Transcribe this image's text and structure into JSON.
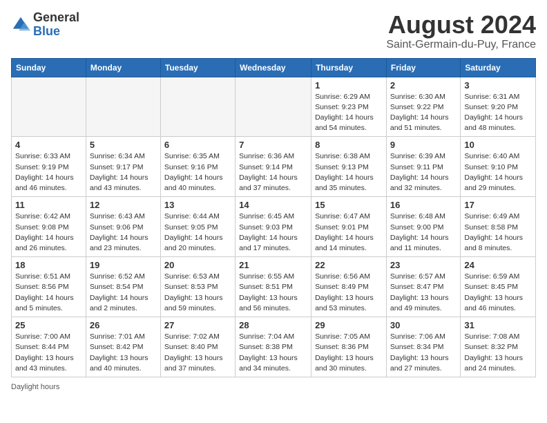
{
  "header": {
    "logo_general": "General",
    "logo_blue": "Blue",
    "month_title": "August 2024",
    "location": "Saint-Germain-du-Puy, France"
  },
  "days_of_week": [
    "Sunday",
    "Monday",
    "Tuesday",
    "Wednesday",
    "Thursday",
    "Friday",
    "Saturday"
  ],
  "footer": {
    "note": "Daylight hours"
  },
  "weeks": [
    [
      {
        "day": "",
        "info": ""
      },
      {
        "day": "",
        "info": ""
      },
      {
        "day": "",
        "info": ""
      },
      {
        "day": "",
        "info": ""
      },
      {
        "day": "1",
        "info": "Sunrise: 6:29 AM\nSunset: 9:23 PM\nDaylight: 14 hours\nand 54 minutes."
      },
      {
        "day": "2",
        "info": "Sunrise: 6:30 AM\nSunset: 9:22 PM\nDaylight: 14 hours\nand 51 minutes."
      },
      {
        "day": "3",
        "info": "Sunrise: 6:31 AM\nSunset: 9:20 PM\nDaylight: 14 hours\nand 48 minutes."
      }
    ],
    [
      {
        "day": "4",
        "info": "Sunrise: 6:33 AM\nSunset: 9:19 PM\nDaylight: 14 hours\nand 46 minutes."
      },
      {
        "day": "5",
        "info": "Sunrise: 6:34 AM\nSunset: 9:17 PM\nDaylight: 14 hours\nand 43 minutes."
      },
      {
        "day": "6",
        "info": "Sunrise: 6:35 AM\nSunset: 9:16 PM\nDaylight: 14 hours\nand 40 minutes."
      },
      {
        "day": "7",
        "info": "Sunrise: 6:36 AM\nSunset: 9:14 PM\nDaylight: 14 hours\nand 37 minutes."
      },
      {
        "day": "8",
        "info": "Sunrise: 6:38 AM\nSunset: 9:13 PM\nDaylight: 14 hours\nand 35 minutes."
      },
      {
        "day": "9",
        "info": "Sunrise: 6:39 AM\nSunset: 9:11 PM\nDaylight: 14 hours\nand 32 minutes."
      },
      {
        "day": "10",
        "info": "Sunrise: 6:40 AM\nSunset: 9:10 PM\nDaylight: 14 hours\nand 29 minutes."
      }
    ],
    [
      {
        "day": "11",
        "info": "Sunrise: 6:42 AM\nSunset: 9:08 PM\nDaylight: 14 hours\nand 26 minutes."
      },
      {
        "day": "12",
        "info": "Sunrise: 6:43 AM\nSunset: 9:06 PM\nDaylight: 14 hours\nand 23 minutes."
      },
      {
        "day": "13",
        "info": "Sunrise: 6:44 AM\nSunset: 9:05 PM\nDaylight: 14 hours\nand 20 minutes."
      },
      {
        "day": "14",
        "info": "Sunrise: 6:45 AM\nSunset: 9:03 PM\nDaylight: 14 hours\nand 17 minutes."
      },
      {
        "day": "15",
        "info": "Sunrise: 6:47 AM\nSunset: 9:01 PM\nDaylight: 14 hours\nand 14 minutes."
      },
      {
        "day": "16",
        "info": "Sunrise: 6:48 AM\nSunset: 9:00 PM\nDaylight: 14 hours\nand 11 minutes."
      },
      {
        "day": "17",
        "info": "Sunrise: 6:49 AM\nSunset: 8:58 PM\nDaylight: 14 hours\nand 8 minutes."
      }
    ],
    [
      {
        "day": "18",
        "info": "Sunrise: 6:51 AM\nSunset: 8:56 PM\nDaylight: 14 hours\nand 5 minutes."
      },
      {
        "day": "19",
        "info": "Sunrise: 6:52 AM\nSunset: 8:54 PM\nDaylight: 14 hours\nand 2 minutes."
      },
      {
        "day": "20",
        "info": "Sunrise: 6:53 AM\nSunset: 8:53 PM\nDaylight: 13 hours\nand 59 minutes."
      },
      {
        "day": "21",
        "info": "Sunrise: 6:55 AM\nSunset: 8:51 PM\nDaylight: 13 hours\nand 56 minutes."
      },
      {
        "day": "22",
        "info": "Sunrise: 6:56 AM\nSunset: 8:49 PM\nDaylight: 13 hours\nand 53 minutes."
      },
      {
        "day": "23",
        "info": "Sunrise: 6:57 AM\nSunset: 8:47 PM\nDaylight: 13 hours\nand 49 minutes."
      },
      {
        "day": "24",
        "info": "Sunrise: 6:59 AM\nSunset: 8:45 PM\nDaylight: 13 hours\nand 46 minutes."
      }
    ],
    [
      {
        "day": "25",
        "info": "Sunrise: 7:00 AM\nSunset: 8:44 PM\nDaylight: 13 hours\nand 43 minutes."
      },
      {
        "day": "26",
        "info": "Sunrise: 7:01 AM\nSunset: 8:42 PM\nDaylight: 13 hours\nand 40 minutes."
      },
      {
        "day": "27",
        "info": "Sunrise: 7:02 AM\nSunset: 8:40 PM\nDaylight: 13 hours\nand 37 minutes."
      },
      {
        "day": "28",
        "info": "Sunrise: 7:04 AM\nSunset: 8:38 PM\nDaylight: 13 hours\nand 34 minutes."
      },
      {
        "day": "29",
        "info": "Sunrise: 7:05 AM\nSunset: 8:36 PM\nDaylight: 13 hours\nand 30 minutes."
      },
      {
        "day": "30",
        "info": "Sunrise: 7:06 AM\nSunset: 8:34 PM\nDaylight: 13 hours\nand 27 minutes."
      },
      {
        "day": "31",
        "info": "Sunrise: 7:08 AM\nSunset: 8:32 PM\nDaylight: 13 hours\nand 24 minutes."
      }
    ]
  ]
}
